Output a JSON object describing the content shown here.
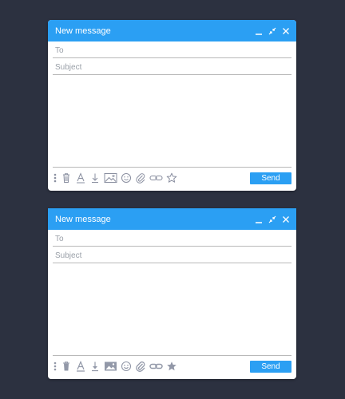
{
  "colors": {
    "background": "#2c3140",
    "accent": "#2b9ff3",
    "icon_outline": "#8a8fa0",
    "icon_filled": "#9298a8"
  },
  "windows": [
    {
      "title": "New message",
      "to": {
        "placeholder": "To",
        "value": ""
      },
      "subject": {
        "placeholder": "Subject",
        "value": ""
      },
      "send_label": "Send",
      "icon_style": "outline",
      "toolbar_icons": [
        "more-vertical-icon",
        "trash-icon",
        "text-format-icon",
        "download-icon",
        "image-icon",
        "emoji-icon",
        "attach-icon",
        "link-icon",
        "star-icon"
      ]
    },
    {
      "title": "New message",
      "to": {
        "placeholder": "To",
        "value": ""
      },
      "subject": {
        "placeholder": "Subject",
        "value": ""
      },
      "send_label": "Send",
      "icon_style": "filled",
      "toolbar_icons": [
        "more-vertical-icon",
        "trash-icon",
        "text-format-icon",
        "download-icon",
        "image-icon",
        "emoji-icon",
        "attach-icon",
        "link-icon",
        "star-icon"
      ]
    }
  ]
}
